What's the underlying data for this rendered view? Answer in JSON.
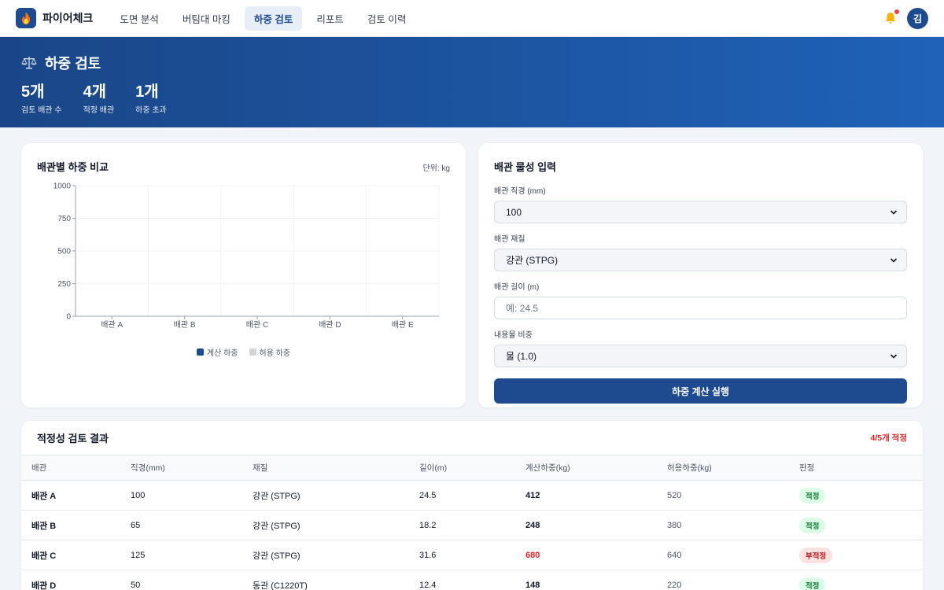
{
  "app": {
    "brand": "파이어체크",
    "user_initial": "김"
  },
  "nav": [
    {
      "label": "도면 분석",
      "active": false
    },
    {
      "label": "버팀대 마킹",
      "active": false
    },
    {
      "label": "하중 검토",
      "active": true
    },
    {
      "label": "리포트",
      "active": false
    },
    {
      "label": "검토 이력",
      "active": false
    }
  ],
  "hero": {
    "title": "하중 검토",
    "stats": [
      {
        "value": "5개",
        "label": "검토 배관 수"
      },
      {
        "value": "4개",
        "label": "적정 배관"
      },
      {
        "value": "1개",
        "label": "하중 초과"
      }
    ]
  },
  "chart_card": {
    "title": "배관별 하중 비교",
    "unit": "단위: kg"
  },
  "chart_data": {
    "type": "bar",
    "categories": [
      "배관 A",
      "배관 B",
      "배관 C",
      "배관 D",
      "배관 E"
    ],
    "ylim": [
      0,
      1000
    ],
    "yticks": [
      0,
      250,
      500,
      750,
      1000
    ],
    "series": [
      {
        "name": "계산 하중",
        "color": "#1e4b8f",
        "values": []
      },
      {
        "name": "허용 하중",
        "color": "#d1d5db",
        "values": []
      }
    ],
    "grid": true,
    "legend": "bottom"
  },
  "form": {
    "title": "배관 물성 입력",
    "diameter_label": "배관 직경 (mm)",
    "diameter_value": "100",
    "material_label": "배관 재질",
    "material_value": "강관 (STPG)",
    "length_label": "배관 길이 (m)",
    "length_placeholder": "예: 24.5",
    "density_label": "내용물 비중",
    "density_value": "물 (1.0)",
    "button": "하중 계산 실행"
  },
  "results": {
    "title": "적정성 검토 결과",
    "summary": "4/5개 적정",
    "columns": [
      "배관",
      "직경(mm)",
      "재질",
      "길이(m)",
      "계산하중(kg)",
      "허용하중(kg)",
      "판정"
    ],
    "rows": [
      {
        "pipe": "배관 A",
        "diameter": "100",
        "material": "강관 (STPG)",
        "length": "24.5",
        "calc": "412",
        "allow": "520",
        "verdict": "적정",
        "ok": true
      },
      {
        "pipe": "배관 B",
        "diameter": "65",
        "material": "강관 (STPG)",
        "length": "18.2",
        "calc": "248",
        "allow": "380",
        "verdict": "적정",
        "ok": true
      },
      {
        "pipe": "배관 C",
        "diameter": "125",
        "material": "강관 (STPG)",
        "length": "31.6",
        "calc": "680",
        "allow": "640",
        "verdict": "부적정",
        "ok": false
      },
      {
        "pipe": "배관 D",
        "diameter": "50",
        "material": "동관 (C1220T)",
        "length": "12.4",
        "calc": "148",
        "allow": "220",
        "verdict": "적정",
        "ok": true
      }
    ]
  }
}
